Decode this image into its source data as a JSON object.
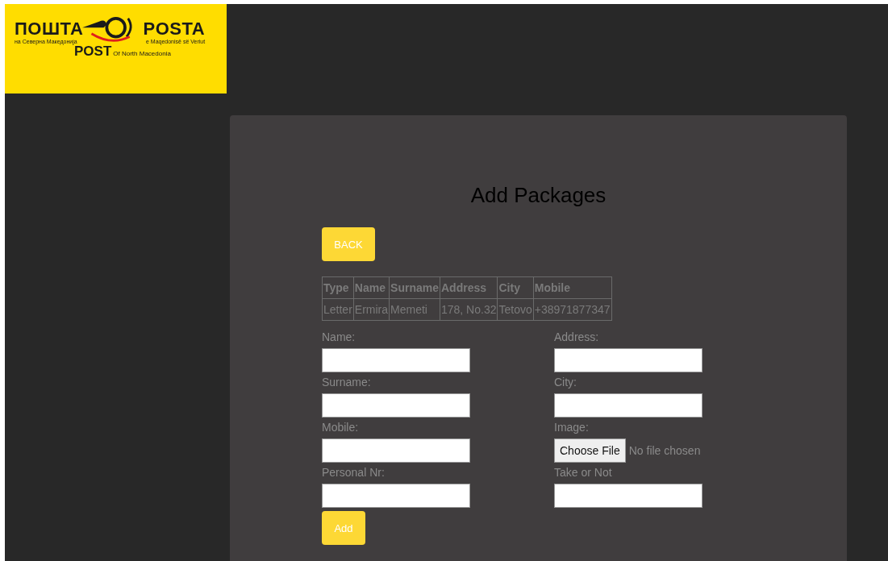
{
  "logo": {
    "mk_title": "ПОШТА",
    "mk_sub": "на Северна Македонија",
    "sq_title": "POSTA",
    "sq_sub": "e Maqedonisë së Veriut",
    "en_title": "POST",
    "en_sub": "Of North Macedonia"
  },
  "title": "Add Packages",
  "back_button": "BACK",
  "table": {
    "columns": [
      "Type",
      "Name",
      "Surname",
      "Address",
      "City",
      "Mobile"
    ],
    "rows": [
      [
        "Letter",
        "Ermira",
        "Memeti",
        "178, No.32",
        "Tetovo",
        "+38971877347"
      ]
    ]
  },
  "form": {
    "left": [
      {
        "label": "Name:",
        "kind": "text"
      },
      {
        "label": "Surname:",
        "kind": "text"
      },
      {
        "label": "Mobile:",
        "kind": "text"
      },
      {
        "label": "Personal Nr:",
        "kind": "text"
      }
    ],
    "right": [
      {
        "label": "Address:",
        "kind": "text"
      },
      {
        "label": "City:",
        "kind": "text"
      },
      {
        "label": "Image:",
        "kind": "file",
        "button": "Choose File",
        "status": "No file chosen"
      },
      {
        "label": "Take or Not",
        "kind": "text"
      }
    ],
    "submit": "Add"
  }
}
